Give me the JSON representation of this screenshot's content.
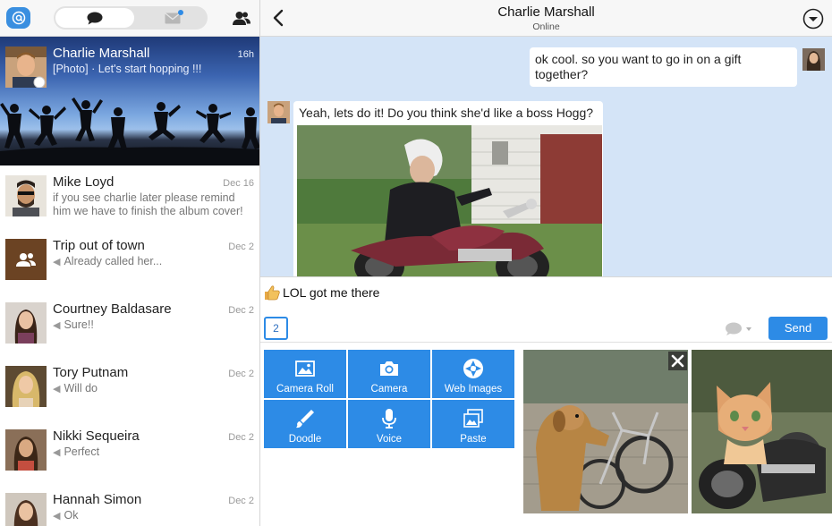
{
  "sidebar": {
    "conversations": [
      {
        "name": "Charlie Marshall",
        "date": "16h",
        "snippet": "[Photo] · Let's start hopping !!!",
        "reply": false
      },
      {
        "name": "Mike Loyd",
        "date": "Dec 16",
        "snippet": "if you see charlie later please remind him we have to finish the album cover!",
        "reply": false
      },
      {
        "name": "Trip out of town",
        "date": "Dec 2",
        "snippet": "Already called her...",
        "reply": true
      },
      {
        "name": "Courtney Baldasare",
        "date": "Dec 2",
        "snippet": "Sure!!",
        "reply": true
      },
      {
        "name": "Tory Putnam",
        "date": "Dec 2",
        "snippet": "Will do",
        "reply": true
      },
      {
        "name": "Nikki Sequeira",
        "date": "Dec 2",
        "snippet": "Perfect",
        "reply": true
      },
      {
        "name": "Hannah Simon",
        "date": "Dec 2",
        "snippet": "Ok",
        "reply": true
      }
    ]
  },
  "chat": {
    "title": "Charlie Marshall",
    "status": "Online",
    "messages": [
      {
        "direction": "out",
        "text": "ok cool. so you want to go in on a gift together?"
      },
      {
        "direction": "in",
        "text": "Yeah, lets do it! Do you think she'd like a boss Hogg?"
      }
    ]
  },
  "composer": {
    "text": "LOL got me there",
    "counter": "2",
    "send_label": "Send"
  },
  "attachments": {
    "tiles": [
      {
        "label": "Camera Roll",
        "icon": "camera-roll-icon"
      },
      {
        "label": "Camera",
        "icon": "camera-icon"
      },
      {
        "label": "Web Images",
        "icon": "web-images-icon"
      },
      {
        "label": "Doodle",
        "icon": "doodle-icon"
      },
      {
        "label": "Voice",
        "icon": "microphone-icon"
      },
      {
        "label": "Paste",
        "icon": "paste-icon"
      }
    ]
  },
  "colors": {
    "accent": "#2d8be6",
    "chat_background": "#d4e4f7",
    "header_background": "#f7f7f7"
  }
}
